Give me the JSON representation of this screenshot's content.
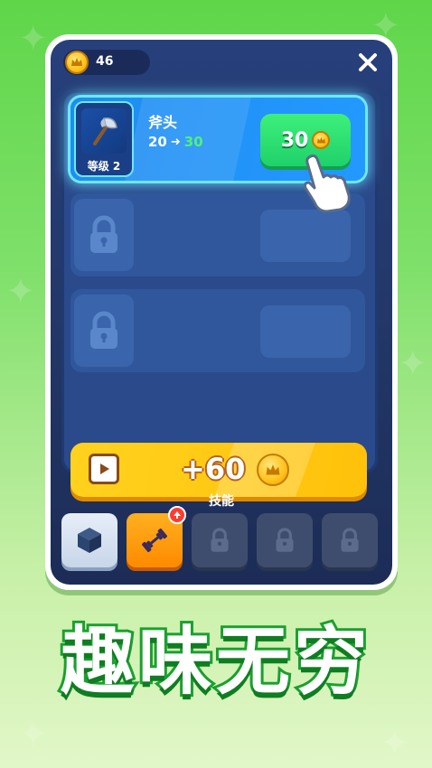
{
  "hud": {
    "coins": "46",
    "close_icon": "close-icon"
  },
  "upgrades": [
    {
      "state": "active",
      "name": "斧头",
      "level_label": "等级 2",
      "stat_from": "20",
      "stat_to": "30",
      "price": "30",
      "icon": "axe-icon"
    },
    {
      "state": "locked",
      "icon": "lock-icon"
    },
    {
      "state": "locked",
      "icon": "lock-icon"
    }
  ],
  "ad_button": {
    "reward": "+60",
    "icon": "video-icon"
  },
  "skills": {
    "label": "技能",
    "tabs": [
      {
        "icon": "cube-icon",
        "state": "unlocked"
      },
      {
        "icon": "dumbbell-icon",
        "state": "selected",
        "badge": "upgrade-arrow-icon"
      },
      {
        "icon": "lock-icon",
        "state": "locked"
      },
      {
        "icon": "lock-icon",
        "state": "locked"
      },
      {
        "icon": "lock-icon",
        "state": "locked"
      }
    ]
  },
  "slogan": "趣味无穷",
  "colors": {
    "accent_green": "#1fd16a",
    "gold": "#ffc10a",
    "panel_blue": "#233868",
    "highlight_cyan": "#6de8ff"
  }
}
